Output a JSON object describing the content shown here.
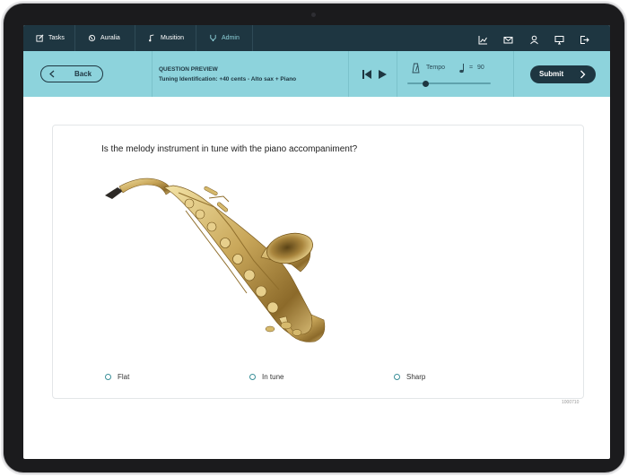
{
  "nav": {
    "tabs": [
      {
        "label": "Tasks",
        "icon": "edit-icon"
      },
      {
        "label": "Auralia",
        "icon": "auralia-icon"
      },
      {
        "label": "Musition",
        "icon": "musition-icon"
      },
      {
        "label": "Admin",
        "icon": "admin-icon"
      }
    ],
    "active_tab": "Admin",
    "right_icons": [
      "chart-icon",
      "mail-icon",
      "user-icon",
      "monitor-icon",
      "logout-icon"
    ]
  },
  "preview": {
    "back_label": "Back",
    "title": "QUESTION PREVIEW",
    "subtitle": "Tuning Identification: +40 cents - Alto sax + Piano",
    "tempo_label": "Tempo",
    "tempo_equals": "=",
    "tempo_value": "90",
    "submit_label": "Submit"
  },
  "question": {
    "text": "Is the melody instrument in tune with the piano accompaniment?",
    "image": "alto-saxophone",
    "options": [
      "Flat",
      "In tune",
      "Sharp"
    ],
    "id": "1000710"
  },
  "colors": {
    "nav_bg": "#1e3641",
    "preview_bg": "#8dd3dc",
    "accent": "#3a8f98",
    "active_tab": "#8fd2da"
  }
}
